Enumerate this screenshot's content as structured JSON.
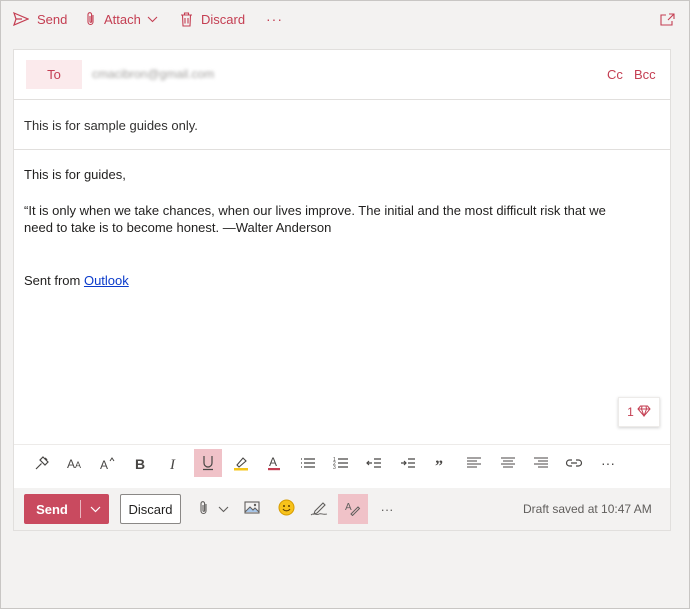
{
  "commandbar": {
    "send_label": "Send",
    "attach_label": "Attach",
    "discard_label": "Discard",
    "more_label": "···"
  },
  "compose": {
    "to_label": "To",
    "recipient": "cmacibron@gmail.com",
    "cc_label": "Cc",
    "bcc_label": "Bcc",
    "subject": "This is for sample guides only.",
    "body": {
      "greeting": "This is for guides,",
      "quote_line1": "“It is only when we take chances, when our lives improve. The initial and the most difficult risk that we",
      "quote_line2": "need to take is to become honest. —Walter Anderson",
      "signature_prefix": "Sent from ",
      "signature_link": "Outlook"
    },
    "insights_count": "1"
  },
  "format_toolbar": {
    "active": [
      "underline"
    ],
    "more_label": "···"
  },
  "actionbar": {
    "send_label": "Send",
    "discard_label": "Discard",
    "more_label": "···",
    "draft_status": "Draft saved at 10:47 AM"
  },
  "colors": {
    "accent": "#c43e52",
    "send_bg": "#c94a5f",
    "active_bg": "#f0c2c8",
    "link": "#0b3bcb"
  }
}
